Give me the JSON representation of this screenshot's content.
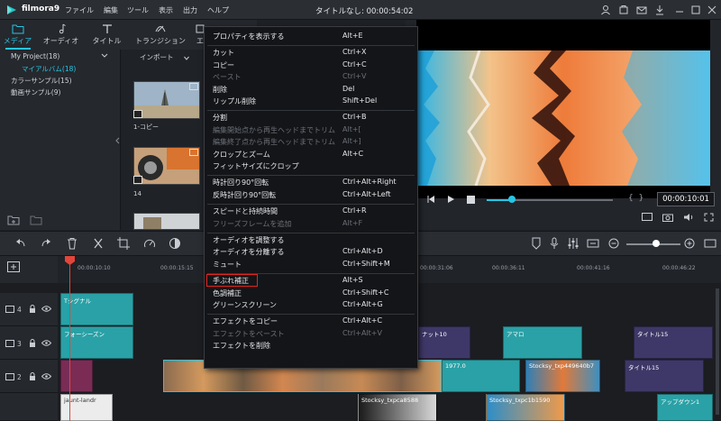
{
  "app": {
    "brand": "filmora9",
    "menu": [
      "ファイル",
      "編集",
      "ツール",
      "表示",
      "出力",
      "ヘルプ"
    ],
    "doc_title": "タイトルなし: 00:00:54:02"
  },
  "media_tabs": [
    {
      "label": "メディア",
      "icon": "folder-icon"
    },
    {
      "label": "オーディオ",
      "icon": "music-note-icon"
    },
    {
      "label": "タイトル",
      "icon": "title-t-icon"
    },
    {
      "label": "トランジション",
      "icon": "transition-icon"
    },
    {
      "label": "エ",
      "icon": "effect-icon"
    }
  ],
  "library": {
    "project": "My Project(18)",
    "my_album": "マイアルバム(18)",
    "color_sample": "カラーサンプル(15)",
    "video_sample": "動画サンプル(9)"
  },
  "media": {
    "import_label": "インポート",
    "thumbs": [
      "1-コピー",
      "14",
      ""
    ]
  },
  "preview": {
    "timecode": "00:00:10:01",
    "progress": 0.2
  },
  "timeline": {
    "ticks": [
      "00:00:10:10",
      "00:00:15:15",
      "00:00:31:06",
      "00:00:36:11",
      "00:00:41:16",
      "00:00:46:22"
    ],
    "tracks": [
      {
        "name": "4"
      },
      {
        "name": "3"
      },
      {
        "name": "2"
      }
    ],
    "clips": {
      "t4_a": "Tシグナル",
      "t3_a": "フォーシーズン",
      "t3_b": "ナット10",
      "t3_c": "アマロ",
      "t3_d": "タイトル15",
      "t2_b": "1977.0",
      "t2_c": "Stocksy_txp449640b7",
      "t2_d": "タイトル15",
      "t1_a": "jaunt-landr",
      "t1_b": "Stocksy_txpca8588",
      "t1_c": "Stocksy_txpc1b1590",
      "t1_d": "アップダウン1"
    },
    "zoom": 0.55
  },
  "context_menu": [
    {
      "label": "プロパティを表示する",
      "shortcut": "Alt+E",
      "disabled": false
    },
    {
      "sep": true
    },
    {
      "label": "カット",
      "shortcut": "Ctrl+X",
      "disabled": false
    },
    {
      "label": "コピー",
      "shortcut": "Ctrl+C",
      "disabled": false
    },
    {
      "label": "ペースト",
      "shortcut": "Ctrl+V",
      "disabled": true
    },
    {
      "label": "削除",
      "shortcut": "Del",
      "disabled": false
    },
    {
      "label": "リップル削除",
      "shortcut": "Shift+Del",
      "disabled": false
    },
    {
      "sep": true
    },
    {
      "label": "分割",
      "shortcut": "Ctrl+B",
      "disabled": false
    },
    {
      "label": "編集開始点から再生ヘッドまでトリム",
      "shortcut": "Alt+[",
      "disabled": true
    },
    {
      "label": "編集終了点から再生ヘッドまでトリム",
      "shortcut": "Alt+]",
      "disabled": true
    },
    {
      "label": "クロップとズーム",
      "shortcut": "Alt+C",
      "disabled": false
    },
    {
      "label": "フィットサイズにクロップ",
      "shortcut": "",
      "disabled": false
    },
    {
      "sep": true
    },
    {
      "label": "時計回り90°回転",
      "shortcut": "Ctrl+Alt+Right",
      "disabled": false
    },
    {
      "label": "反時計回り90°回転",
      "shortcut": "Ctrl+Alt+Left",
      "disabled": false
    },
    {
      "sep": true
    },
    {
      "label": "スピードと持続時間",
      "shortcut": "Ctrl+R",
      "disabled": false
    },
    {
      "label": "フリーズフレームを追加",
      "shortcut": "Alt+F",
      "disabled": true
    },
    {
      "sep": true
    },
    {
      "label": "オーディオを調整する",
      "shortcut": "",
      "disabled": false
    },
    {
      "label": "オーディオを分離する",
      "shortcut": "Ctrl+Alt+D",
      "disabled": false
    },
    {
      "label": "ミュート",
      "shortcut": "Ctrl+Shift+M",
      "disabled": false
    },
    {
      "sep": true
    },
    {
      "label": "手ぶれ補正",
      "shortcut": "Alt+S",
      "disabled": false,
      "highlight": true
    },
    {
      "label": "色調補正",
      "shortcut": "Ctrl+Shift+C",
      "disabled": false
    },
    {
      "label": "グリーンスクリーン",
      "shortcut": "Ctrl+Alt+G",
      "disabled": false
    },
    {
      "sep": true
    },
    {
      "label": "エフェクトをコピー",
      "shortcut": "Ctrl+Alt+C",
      "disabled": false
    },
    {
      "label": "エフェクトをペースト",
      "shortcut": "Ctrl+Alt+V",
      "disabled": true
    },
    {
      "label": "エフェクトを削除",
      "shortcut": "",
      "disabled": false
    }
  ],
  "colors": {
    "accent": "#27c5e5",
    "highlight_box": "#e5231d",
    "clip_teal": "#2aa1a6",
    "clip_purple": "#3e3868"
  }
}
